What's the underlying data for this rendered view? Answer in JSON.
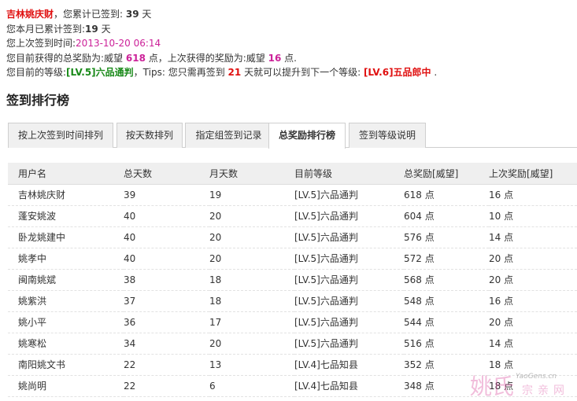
{
  "info": {
    "username": "吉林姚庆财",
    "l1_text": "，您累计已签到:",
    "total_days": "39",
    "l1_unit": "天",
    "l2_text": "您本月已累计签到:",
    "month_days": "19",
    "l2_unit": "天",
    "l3_text": "您上次签到时间:",
    "last_time": "2013-10-20 06:14",
    "l4_text_a": "您目前获得的总奖励为:威望",
    "total_reward": "618",
    "l4_text_b": "点，上次获得的奖励为:威望",
    "last_reward": "16",
    "l4_text_c": "点.",
    "l5_text_a": "您目前的等级:",
    "current_level": "[LV.5]六品通判",
    "l5_text_b": "，Tips: 您只需再签到",
    "days_needed": "21",
    "l5_text_c": "天就可以提升到下一个等级:",
    "next_level": "[LV.6]五品郎中",
    "l5_text_d": "."
  },
  "section_title": "签到排行榜",
  "tabs": [
    {
      "label": "按上次签到时间排列"
    },
    {
      "label": "按天数排列"
    },
    {
      "label": "指定组签到记录"
    },
    {
      "label": "总奖励排行榜"
    },
    {
      "label": "签到等级说明"
    }
  ],
  "active_tab": "总奖励排行榜",
  "table": {
    "headers": [
      "用户名",
      "总天数",
      "月天数",
      "目前等级",
      "总奖励[威望]",
      "上次奖励[威望]"
    ],
    "rows": [
      [
        "吉林姚庆财",
        "39",
        "19",
        "[LV.5]六品通判",
        "618 点",
        "16 点"
      ],
      [
        "蓬安姚波",
        "40",
        "20",
        "[LV.5]六品通判",
        "604 点",
        "10 点"
      ],
      [
        "卧龙姚建中",
        "40",
        "20",
        "[LV.5]六品通判",
        "576 点",
        "14 点"
      ],
      [
        "姚孝中",
        "40",
        "20",
        "[LV.5]六品通判",
        "572 点",
        "20 点"
      ],
      [
        "闽南姚斌",
        "38",
        "18",
        "[LV.5]六品通判",
        "568 点",
        "20 点"
      ],
      [
        "姚紫洪",
        "37",
        "18",
        "[LV.5]六品通判",
        "548 点",
        "16 点"
      ],
      [
        "姚小平",
        "36",
        "17",
        "[LV.5]六品通判",
        "544 点",
        "20 点"
      ],
      [
        "姚寒松",
        "34",
        "20",
        "[LV.5]六品通判",
        "516 点",
        "14 点"
      ],
      [
        "南阳姚文书",
        "22",
        "13",
        "[LV.4]七品知县",
        "352 点",
        "18 点"
      ],
      [
        "姚尚明",
        "22",
        "6",
        "[LV.4]七品知县",
        "348 点",
        "18 点"
      ]
    ]
  },
  "watermark": {
    "big": "姚氏",
    "small": "YaoGens.cn",
    "sub": "宗亲网"
  },
  "colors": {
    "red": "#e01010",
    "magenta": "#cc2299",
    "green": "#1a8a1a"
  }
}
